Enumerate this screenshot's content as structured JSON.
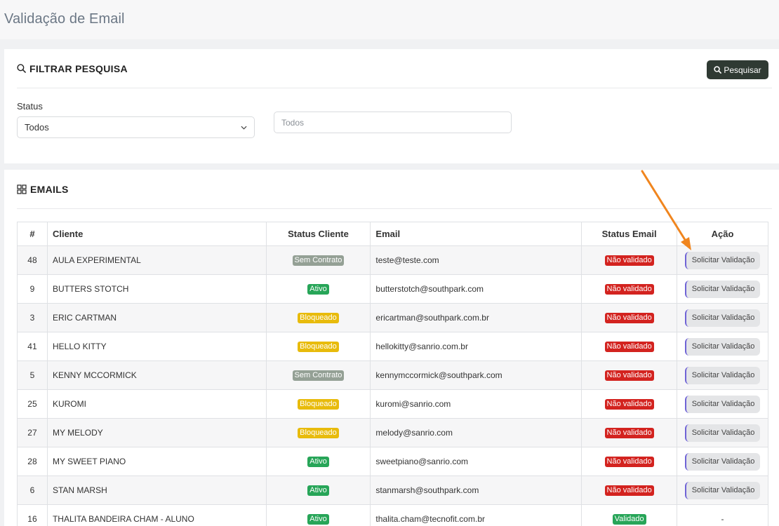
{
  "page": {
    "title": "Validação de Email"
  },
  "filter": {
    "title": "FILTRAR PESQUISA",
    "search_button": "Pesquisar",
    "status_label": "Status",
    "status_value": "Todos",
    "search_placeholder": "Todos"
  },
  "emails": {
    "title": "EMAILS",
    "columns": [
      "#",
      "Cliente",
      "Status Cliente",
      "Email",
      "Status Email",
      "Ação"
    ],
    "rows": [
      {
        "id": "48",
        "cliente": "AULA EXPERIMENTAL",
        "status_cliente": "Sem Contrato",
        "email": "teste@teste.com",
        "status_email": "Não validado",
        "acao": "Solicitar Validação"
      },
      {
        "id": "9",
        "cliente": "BUTTERS STOTCH",
        "status_cliente": "Ativo",
        "email": "butterstotch@southpark.com",
        "status_email": "Não validado",
        "acao": "Solicitar Validação"
      },
      {
        "id": "3",
        "cliente": "ERIC CARTMAN",
        "status_cliente": "Bloqueado",
        "email": "ericartman@southpark.com.br",
        "status_email": "Não validado",
        "acao": "Solicitar Validação"
      },
      {
        "id": "41",
        "cliente": "HELLO KITTY",
        "status_cliente": "Bloqueado",
        "email": "hellokitty@sanrio.com.br",
        "status_email": "Não validado",
        "acao": "Solicitar Validação"
      },
      {
        "id": "5",
        "cliente": "KENNY MCCORMICK",
        "status_cliente": "Sem Contrato",
        "email": "kennymccormick@southpark.com",
        "status_email": "Não validado",
        "acao": "Solicitar Validação"
      },
      {
        "id": "25",
        "cliente": "KUROMI",
        "status_cliente": "Bloqueado",
        "email": "kuromi@sanrio.com",
        "status_email": "Não validado",
        "acao": "Solicitar Validação"
      },
      {
        "id": "27",
        "cliente": "MY MELODY",
        "status_cliente": "Bloqueado",
        "email": "melody@sanrio.com",
        "status_email": "Não validado",
        "acao": "Solicitar Validação"
      },
      {
        "id": "28",
        "cliente": "MY SWEET PIANO",
        "status_cliente": "Ativo",
        "email": "sweetpiano@sanrio.com",
        "status_email": "Não validado",
        "acao": "Solicitar Validação"
      },
      {
        "id": "6",
        "cliente": "STAN MARSH",
        "status_cliente": "Ativo",
        "email": "stanmarsh@southpark.com",
        "status_email": "Não validado",
        "acao": "Solicitar Validação"
      },
      {
        "id": "16",
        "cliente": "THALITA BANDEIRA CHAM - ALUNO",
        "status_cliente": "Ativo",
        "email": "thalita.cham@tecnofit.com.br",
        "status_email": "Validado",
        "acao": "-"
      }
    ]
  },
  "colors": {
    "Sem Contrato": "#94a095",
    "Ativo": "#27a558",
    "Bloqueado": "#e8bb0c",
    "Não validado": "#d3231f",
    "Validado": "#27a558",
    "annotation_arrow": "#f0851e"
  },
  "icons": {
    "search": "search-icon",
    "grid": "grid-icon",
    "chevron": "chevron-down-icon"
  }
}
